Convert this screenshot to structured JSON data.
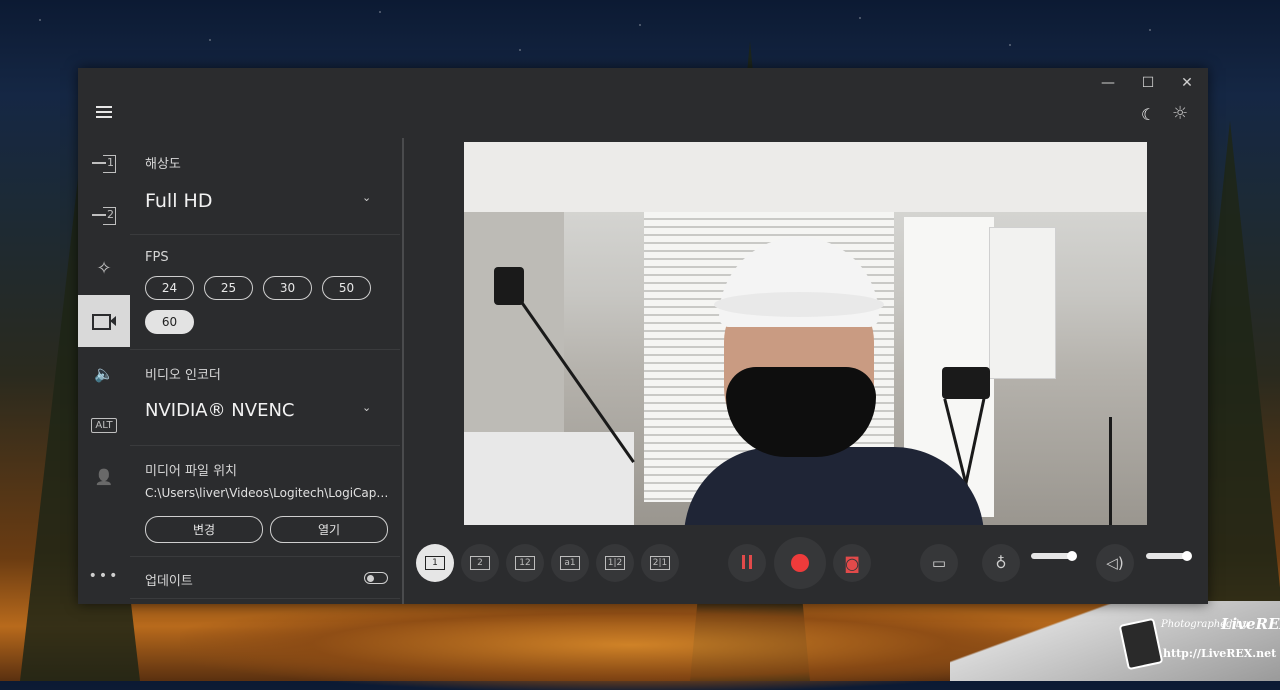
{
  "window": {
    "controls": {
      "minimize": "—",
      "maximize": "☐",
      "close": "✕"
    },
    "theme": {
      "dark_icon": "moon-icon",
      "light_icon": "sun-icon"
    }
  },
  "rail": {
    "items": [
      {
        "name": "source-1",
        "num": "1"
      },
      {
        "name": "source-2",
        "num": "2"
      },
      {
        "name": "effects",
        "glyph": "✧"
      },
      {
        "name": "video",
        "active": true
      },
      {
        "name": "audio",
        "glyph": "🔈"
      },
      {
        "name": "alt",
        "text": "ALT"
      },
      {
        "name": "account",
        "glyph": "👤"
      }
    ],
    "more": "•••"
  },
  "panel": {
    "resolution": {
      "label": "해상도",
      "value": "Full HD"
    },
    "fps": {
      "label": "FPS",
      "options": [
        "24",
        "25",
        "30",
        "50",
        "60"
      ],
      "selected": "60"
    },
    "encoder": {
      "label": "비디오 인코더",
      "value": "NVIDIA® NVENC"
    },
    "media": {
      "label": "미디어 파일 위치",
      "path": "C:\\Users\\liver\\Videos\\Logitech\\LogiCapture",
      "change": "변경",
      "open": "열기"
    },
    "update": {
      "label": "업데이트",
      "enabled": false
    }
  },
  "bottombar": {
    "layouts": [
      "1",
      "2",
      "12",
      "a1",
      "1|2",
      "2|1"
    ],
    "selected_layout": "1",
    "buttons": {
      "pause": "pause-icon",
      "record": "record-icon",
      "snapshot": "camera-icon",
      "folder": "folder-icon",
      "mic": "mic-icon",
      "speaker": "speaker-icon"
    },
    "mic_level": 0.9,
    "speaker_level": 0.9
  },
  "watermark": {
    "line1": "Photographed by",
    "brand": "LiveREX",
    "url": "http://LiveREX.net"
  },
  "colors": {
    "accent_red": "#ee3b3b",
    "panel_bg": "#2b2c2e",
    "selected": "#e3e3e3"
  }
}
